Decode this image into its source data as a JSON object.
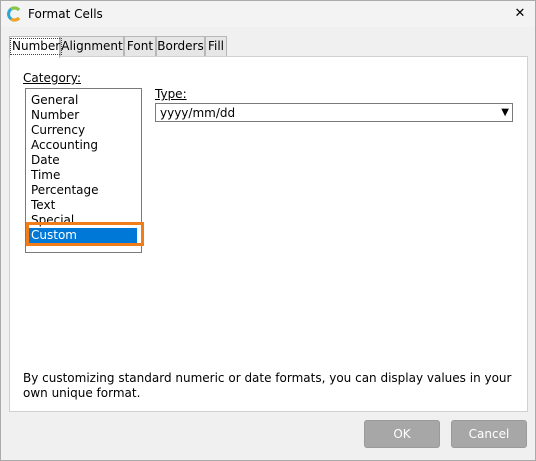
{
  "window": {
    "title": "Format Cells",
    "close_glyph": "✕",
    "icon": "app-logo-icon"
  },
  "tabs": [
    {
      "label": "Number",
      "active": true
    },
    {
      "label": "Alignment",
      "active": false
    },
    {
      "label": "Font",
      "active": false
    },
    {
      "label": "Borders",
      "active": false
    },
    {
      "label": "Fill",
      "active": false
    }
  ],
  "category": {
    "label": "Category:",
    "items": [
      "General",
      "Number",
      "Currency",
      "Accounting",
      "Date",
      "Time",
      "Percentage",
      "Text",
      "Special",
      "Custom"
    ],
    "selected": "Custom"
  },
  "type": {
    "label": "Type:",
    "value": "yyyy/mm/dd"
  },
  "description": "By customizing standard numeric or date formats, you can display values in your own unique format.",
  "buttons": {
    "ok": "OK",
    "cancel": "Cancel"
  },
  "colors": {
    "selection": "#0078d7",
    "highlight": "#f07c1a",
    "button": "#a7a7a7"
  }
}
